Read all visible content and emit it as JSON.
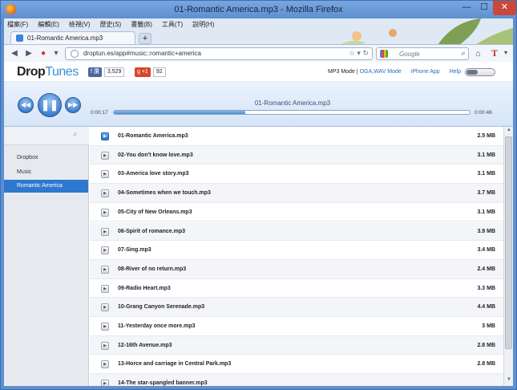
{
  "window": {
    "title": "01-Romantic America.mp3 - Mozilla Firefox",
    "minimize": "—",
    "maximize": "☐",
    "close": "✕"
  },
  "menubar": [
    "檔案(F)",
    "編輯(E)",
    "檢視(V)",
    "歷史(S)",
    "書籤(B)",
    "工具(T)",
    "說明(H)"
  ],
  "tab": {
    "label": "01-Romantic America.mp3",
    "new_tab": "+"
  },
  "navbar": {
    "url": "droptun.es/app#music::romantic+america",
    "search_placeholder": "Google"
  },
  "app": {
    "logo_drop": "Drop",
    "logo_tunes": "Tunes",
    "fb_like": "f 讚",
    "fb_count": "3,529",
    "gplus_label": "g +1",
    "gplus_count": "92",
    "nav": {
      "mode_label": "MP3 Mode",
      "mode_sep": "|",
      "mode_link": "OGA,WAV Mode",
      "iphone": "iPhone App",
      "help": "Help"
    }
  },
  "player": {
    "now_playing": "01-Romantic America.mp3",
    "time_current": "0:00:17",
    "time_total": "0:00:46",
    "progress_fraction": 0.37,
    "prev_icon": "◀◀",
    "play_icon": "❚❚",
    "next_icon": "▶▶"
  },
  "sidebar": {
    "items": [
      "Dropbox",
      "Music",
      "Romantic America"
    ],
    "active_index": 2
  },
  "tracks": [
    {
      "name": "01-Romantic America.mp3",
      "size": "2.5 MB"
    },
    {
      "name": "02-You don't know love.mp3",
      "size": "3.1 MB"
    },
    {
      "name": "03-America love story.mp3",
      "size": "3.1 MB"
    },
    {
      "name": "04-Sometimes when we touch.mp3",
      "size": "3.7 MB"
    },
    {
      "name": "05-City of New Orleans.mp3",
      "size": "3.1 MB"
    },
    {
      "name": "06-Spirit of romance.mp3",
      "size": "3.9 MB"
    },
    {
      "name": "07-Sing.mp3",
      "size": "3.4 MB"
    },
    {
      "name": "08-River of no return.mp3",
      "size": "2.4 MB"
    },
    {
      "name": "09-Radio Heart.mp3",
      "size": "3.3 MB"
    },
    {
      "name": "10-Grang Canyon Serenade.mp3",
      "size": "4.4 MB"
    },
    {
      "name": "11-Yesterday once more.mp3",
      "size": "3 MB"
    },
    {
      "name": "12-16th Avenue.mp3",
      "size": "2.8 MB"
    },
    {
      "name": "13-Horce and carriage in Central Park.mp3",
      "size": "2.8 MB"
    },
    {
      "name": "14-The star-spangled banner.mp3",
      "size": ""
    }
  ],
  "colors": {
    "accent": "#2e78cf",
    "window_frame": "#5e8fd0",
    "close_button": "#c9473b"
  }
}
